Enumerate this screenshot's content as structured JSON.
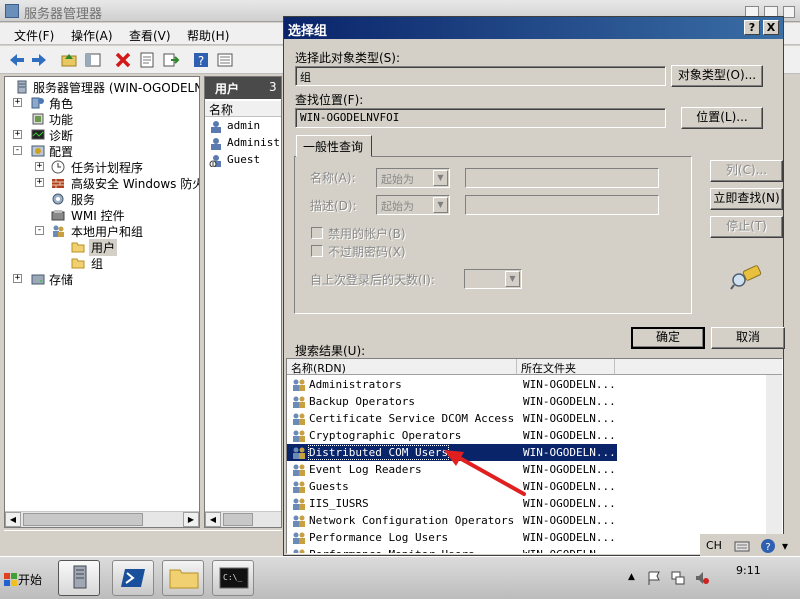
{
  "server_manager": {
    "title": "服务器管理器",
    "menu": [
      "文件(F)",
      "操作(A)",
      "查看(V)",
      "帮助(H)"
    ],
    "tree": [
      {
        "label": "服务器管理器 (WIN-OGODELNVFO",
        "level": 0,
        "expander": ""
      },
      {
        "label": "角色",
        "level": 1,
        "expander": "+"
      },
      {
        "label": "功能",
        "level": 1,
        "expander": ""
      },
      {
        "label": "诊断",
        "level": 1,
        "expander": "+"
      },
      {
        "label": "配置",
        "level": 1,
        "expander": "-"
      },
      {
        "label": "任务计划程序",
        "level": 2,
        "expander": "+"
      },
      {
        "label": "高级安全 Windows 防火墙",
        "level": 2,
        "expander": "+"
      },
      {
        "label": "服务",
        "level": 2,
        "expander": ""
      },
      {
        "label": "WMI 控件",
        "level": 2,
        "expander": ""
      },
      {
        "label": "本地用户和组",
        "level": 2,
        "expander": "-"
      },
      {
        "label": "用户",
        "level": 3,
        "expander": "",
        "selected": true
      },
      {
        "label": "组",
        "level": 3,
        "expander": ""
      },
      {
        "label": "存储",
        "level": 0,
        "expander": "+"
      }
    ],
    "user_pane": {
      "header": "用户",
      "header_count": "3",
      "column": "名称",
      "users": [
        "admin",
        "Administrator",
        "Guest"
      ]
    }
  },
  "dialog": {
    "title": "选择组",
    "help_button": "?",
    "close_button": "X",
    "object_type_label": "选择此对象类型(S):",
    "object_type_value": "组",
    "object_type_button": "对象类型(O)...",
    "location_label": "查找位置(F):",
    "location_value": "WIN-OGODELNVFOI",
    "location_button": "位置(L)...",
    "tab_general": "一般性查询",
    "name_label": "名称(A):",
    "name_combo": "起始为",
    "desc_label": "描述(D):",
    "desc_combo": "起始为",
    "disabled_accounts": "禁用的帐户(B)",
    "no_expire": "不过期密码(X)",
    "days_label": "自上次登录后的天数(I):",
    "columns_button": "列(C)...",
    "find_now_button": "立即查找(N)",
    "stop_button": "停止(T)",
    "ok_button": "确定",
    "cancel_button": "取消",
    "results_label": "搜索结果(U):",
    "results_columns": [
      "名称(RDN)",
      "所在文件夹"
    ],
    "results": [
      {
        "name": "Administrators",
        "folder": "WIN-OGODELN..."
      },
      {
        "name": "Backup Operators",
        "folder": "WIN-OGODELN..."
      },
      {
        "name": "Certificate Service DCOM Access",
        "folder": "WIN-OGODELN..."
      },
      {
        "name": "Cryptographic Operators",
        "folder": "WIN-OGODELN..."
      },
      {
        "name": "Distributed COM Users",
        "folder": "WIN-OGODELN...",
        "selected": true
      },
      {
        "name": "Event Log Readers",
        "folder": "WIN-OGODELN..."
      },
      {
        "name": "Guests",
        "folder": "WIN-OGODELN..."
      },
      {
        "name": "IIS_IUSRS",
        "folder": "WIN-OGODELN..."
      },
      {
        "name": "Network Configuration Operators",
        "folder": "WIN-OGODELN..."
      },
      {
        "name": "Performance Log Users",
        "folder": "WIN-OGODELN..."
      },
      {
        "name": "Performance Monitor Users",
        "folder": "WIN-OGODELN..."
      }
    ]
  },
  "taskbar": {
    "start_label": "开始",
    "lang": "CH",
    "clock": "9:11"
  },
  "colors": {
    "selection": "#0a246a",
    "title_gradient_start": "#0a246a",
    "title_gradient_end": "#3a6ea5",
    "annotation_arrow": "#e02020"
  }
}
